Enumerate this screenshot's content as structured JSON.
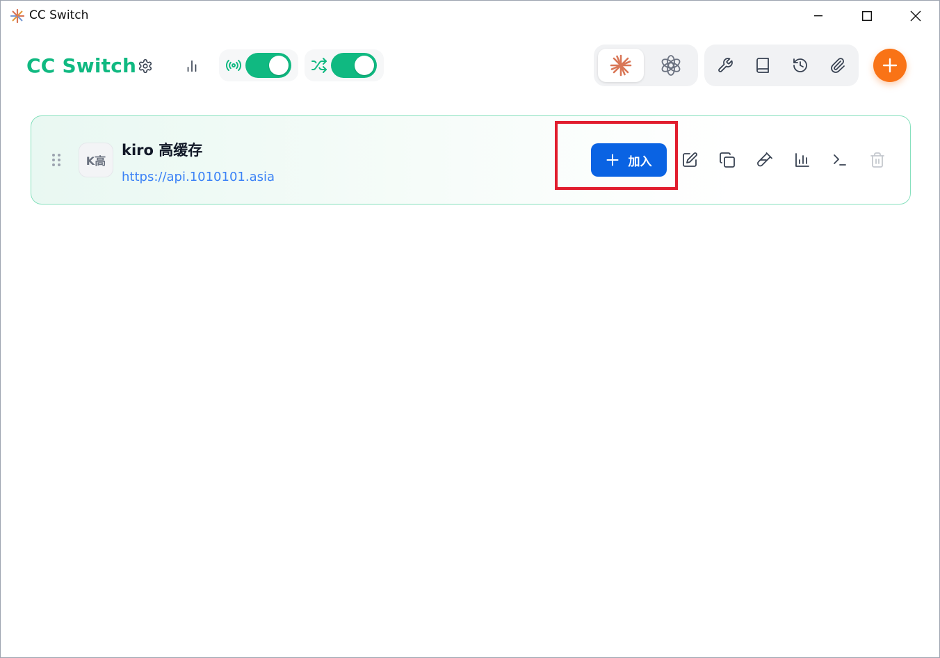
{
  "window": {
    "title": "CC Switch"
  },
  "header": {
    "brand": "CC Switch"
  },
  "provider": {
    "avatar": "K高",
    "name": "kiro 高缓存",
    "url": "https://api.1010101.asia",
    "join_label": "加入"
  },
  "colors": {
    "brand_green": "#10b981",
    "accent_orange": "#f97316",
    "primary_blue": "#0a63e3",
    "highlight_red": "#e11d2e"
  },
  "icons": {
    "titlebar": "claude-sunburst-icon",
    "settings": "gear-icon",
    "stats": "bar-chart-icon",
    "proxy": "broadcast-icon",
    "failover": "shuffle-icon",
    "apps": [
      "claude-icon",
      "openai-icon"
    ],
    "tools": [
      "wrench-icon",
      "book-icon",
      "history-icon",
      "paperclip-icon"
    ],
    "row_actions": [
      "edit-icon",
      "copy-icon",
      "test-icon",
      "usage-chart-icon",
      "terminal-icon",
      "trash-icon"
    ]
  }
}
